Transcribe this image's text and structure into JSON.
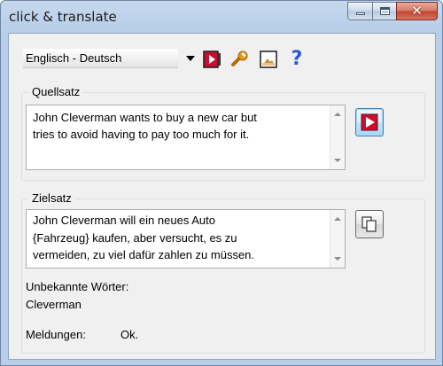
{
  "window": {
    "title": "click & translate",
    "min_label": "minimize",
    "max_label": "maximize",
    "close_label": "close"
  },
  "toolbar": {
    "language_pair": "Englisch - Deutsch",
    "icons": [
      "flag-arrow-icon",
      "wrench-icon",
      "image-icon",
      "help-icon"
    ],
    "help_glyph": "?"
  },
  "source": {
    "label": "Quellsatz",
    "text": "John Cleverman wants to buy a new car but\ntries to avoid having to pay too much for it.",
    "translate_icon": "play-arrow-icon"
  },
  "target": {
    "label": "Zielsatz",
    "text": "John Cleverman will ein neues Auto\n{Fahrzeug} kaufen, aber versucht, es zu\nvermeiden, zu viel dafür zahlen zu müssen.",
    "copy_icon": "copy-icon"
  },
  "unknown_words": {
    "label": "Unbekannte Wörter:",
    "value": "Cleverman"
  },
  "messages": {
    "label": "Meldungen:",
    "value": "Ok."
  },
  "colors": {
    "accent_red": "#c8102e",
    "active_button": "#bee6fd",
    "title_bar": "#b9cfe9"
  }
}
